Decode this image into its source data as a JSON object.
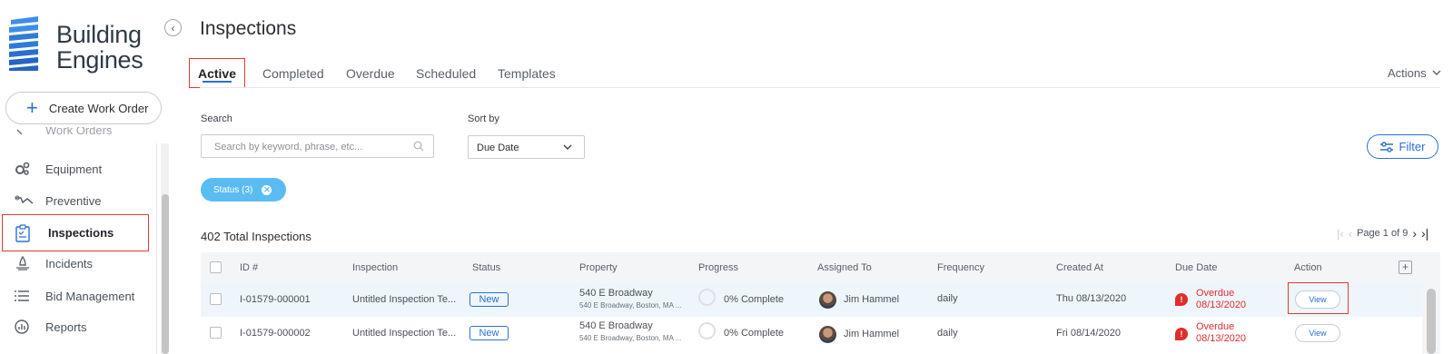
{
  "brand": {
    "line1": "Building",
    "line2": "Engines"
  },
  "sidebar": {
    "create_label": "Create Work Order",
    "partial_item": "Work Orders",
    "items": [
      {
        "label": "Equipment",
        "icon": "gears-icon"
      },
      {
        "label": "Preventive",
        "icon": "preventive-icon"
      },
      {
        "label": "Inspections",
        "icon": "clipboard-icon",
        "active": true
      },
      {
        "label": "Incidents",
        "icon": "incidents-icon"
      },
      {
        "label": "Bid Management",
        "icon": "list-icon"
      },
      {
        "label": "Reports",
        "icon": "reports-icon"
      }
    ]
  },
  "page": {
    "title": "Inspections",
    "actions_label": "Actions"
  },
  "tabs": [
    {
      "label": "Active",
      "active": true
    },
    {
      "label": "Completed"
    },
    {
      "label": "Overdue"
    },
    {
      "label": "Scheduled"
    },
    {
      "label": "Templates"
    }
  ],
  "search": {
    "label": "Search",
    "placeholder": "Search by keyword, phrase, etc..."
  },
  "sort": {
    "label": "Sort by",
    "value": "Due Date"
  },
  "filter": {
    "label": "Filter"
  },
  "chip": {
    "label": "Status (3)"
  },
  "summary": {
    "total": "402 Total Inspections",
    "page": "Page 1 of 9"
  },
  "table": {
    "columns": [
      "ID #",
      "Inspection",
      "Status",
      "Property",
      "Progress",
      "Assigned To",
      "Frequency",
      "Created At",
      "Due Date",
      "Action"
    ],
    "rows": [
      {
        "id": "I-01579-000001",
        "inspection": "Untitled Inspection Te...",
        "status": "New",
        "property": "540 E Broadway",
        "address": "540 E Broadway, Boston, MA ...",
        "progress": "0% Complete",
        "assigned": "Jim Hammel",
        "frequency": "daily",
        "created": "Thu 08/13/2020",
        "due_label": "Overdue",
        "due_date": "08/13/2020",
        "action": "View"
      },
      {
        "id": "I-01579-000002",
        "inspection": "Untitled Inspection Te...",
        "status": "New",
        "property": "540 E Broadway",
        "address": "540 E Broadway, Boston, MA ...",
        "progress": "0% Complete",
        "assigned": "Jim Hammel",
        "frequency": "daily",
        "created": "Fri 08/14/2020",
        "due_label": "Overdue",
        "due_date": "08/13/2020",
        "action": "View"
      }
    ]
  },
  "colors": {
    "accent": "#2a6fd6",
    "highlight": "#e23b2e",
    "overdue": "#e02d2d",
    "chip": "#5bbcf3"
  }
}
